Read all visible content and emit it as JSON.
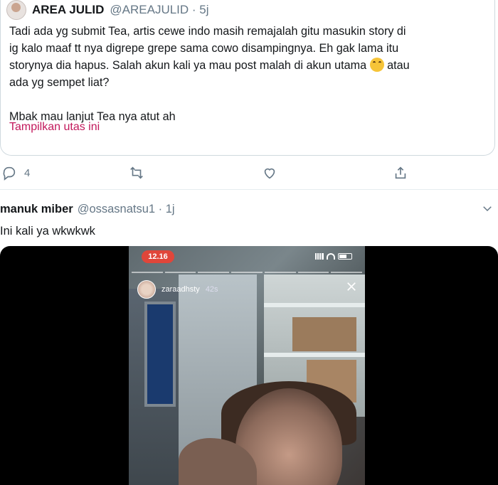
{
  "quote": {
    "name": "AREA JULID",
    "handle": "@AREAJULID · 5j",
    "body": "Tadi ada yg submit Tea, artis cewe indo masih remajalah gitu masukin story di\nig kalo maaf tt nya digrepe grepe sama cowo disampingnya. Eh gak lama itu\nstorynya dia hapus. Salah akun kali ya mau post malah di akun utama",
    "body_after_emoji": " atau\nada yg sempet liat?\n\nMbak mau lanjut Tea nya atut ah",
    "emoji": "tears-of-joy-emoji",
    "show_thread": "Tampilkan utas ini"
  },
  "actions": {
    "reply_count": "4",
    "icons": [
      "reply-icon",
      "retweet-icon",
      "like-icon",
      "share-icon"
    ]
  },
  "reply": {
    "name": "manuk miber",
    "handle": "@ossasnatsu1 · 1j",
    "text": "Ini kali ya wkwkwk"
  },
  "story": {
    "time": "12.16",
    "username": "zaraadhsty",
    "age": "42s"
  },
  "colors": {
    "link": "#c2185b",
    "secondary_text": "#657786",
    "story_time_badge": "#e0463a"
  }
}
